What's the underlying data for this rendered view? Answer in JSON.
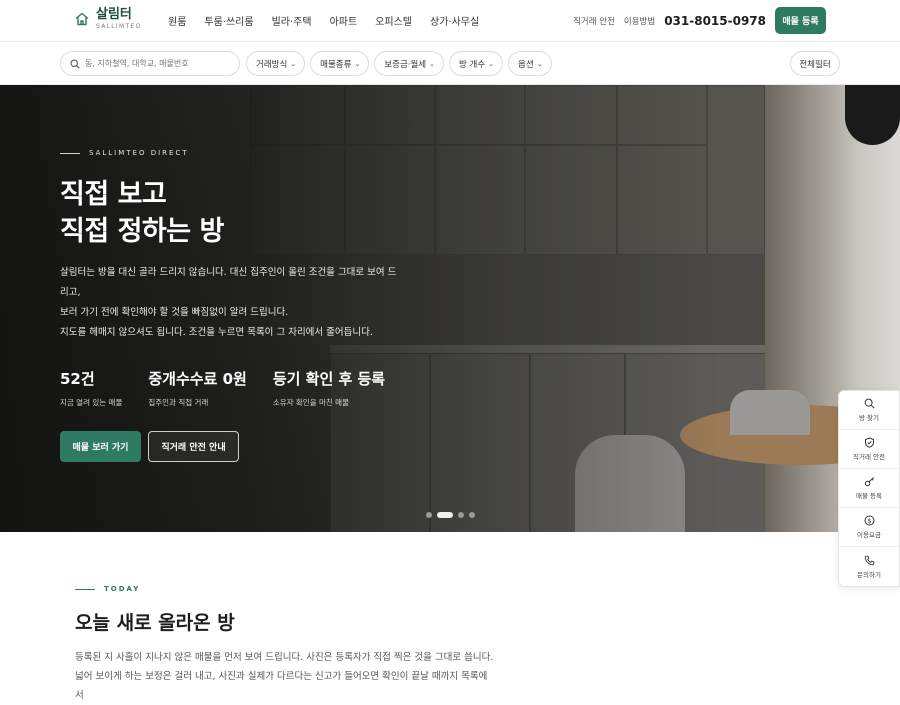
{
  "brand": {
    "name_ko": "살림터",
    "name_en": "SALLIMTEO"
  },
  "nav": {
    "items": [
      "원룸",
      "투룸·쓰리룸",
      "빌라·주택",
      "아파트",
      "오피스텔",
      "상가·사무실"
    ]
  },
  "header_right": {
    "safe_trade": "직거래 안전",
    "usage": "이용방법",
    "phone": "031-8015-0978",
    "register_button": "매물 등록"
  },
  "search": {
    "placeholder": "동, 지하철역, 대학교, 매물번호"
  },
  "filters": [
    "거래방식",
    "매물종류",
    "보증금·월세",
    "방 개수",
    "옵션"
  ],
  "all_filter": "전체필터",
  "hero": {
    "eyebrow": "SALLIMTEO DIRECT",
    "title": "직접 보고\n직접 정하는 방",
    "description": "살림터는 방을 대신 골라 드리지 않습니다. 대신 집주인이 올린 조건을 그대로 보여 드리고,\n보러 가기 전에 확인해야 할 것을 빠짐없이 알려 드립니다.\n지도를 헤매지 않으셔도 됩니다. 조건을 누르면 목록이 그 자리에서 줄어듭니다.",
    "stats": [
      {
        "value": "52건",
        "label": "지금 열려 있는 매물"
      },
      {
        "value": "중개수수료 0원",
        "label": "집주인과 직접 거래"
      },
      {
        "value": "등기 확인 후 등록",
        "label": "소유자 확인을 마친 매물"
      }
    ],
    "primary_button": "매물 보러 가기",
    "secondary_button": "직거래 안전 안내",
    "slides": {
      "count": 4,
      "active": 2
    }
  },
  "quick_menu": [
    {
      "label": "방 찾기",
      "icon": "search-icon"
    },
    {
      "label": "직거래 안전",
      "icon": "shield-icon"
    },
    {
      "label": "매물 등록",
      "icon": "key-icon"
    },
    {
      "label": "이용요금",
      "icon": "dollar-icon"
    },
    {
      "label": "문의하기",
      "icon": "phone-icon"
    }
  ],
  "today": {
    "eyebrow": "TODAY",
    "title": "오늘 새로 올라온 방",
    "description": "등록된 지 사흘이 지나지 않은 매물을 먼저 보여 드립니다. 사진은 등록자가 직접 찍은 것을 그대로 씁니다. 넓어 보이게 하는 보정은 걸러 내고, 사진과 실제가 다르다는 신고가 들어오면 확인이 끝날 때까지 목록에서"
  },
  "colors": {
    "accent": "#2f7a62",
    "brand_dark": "#1f4d3f"
  }
}
